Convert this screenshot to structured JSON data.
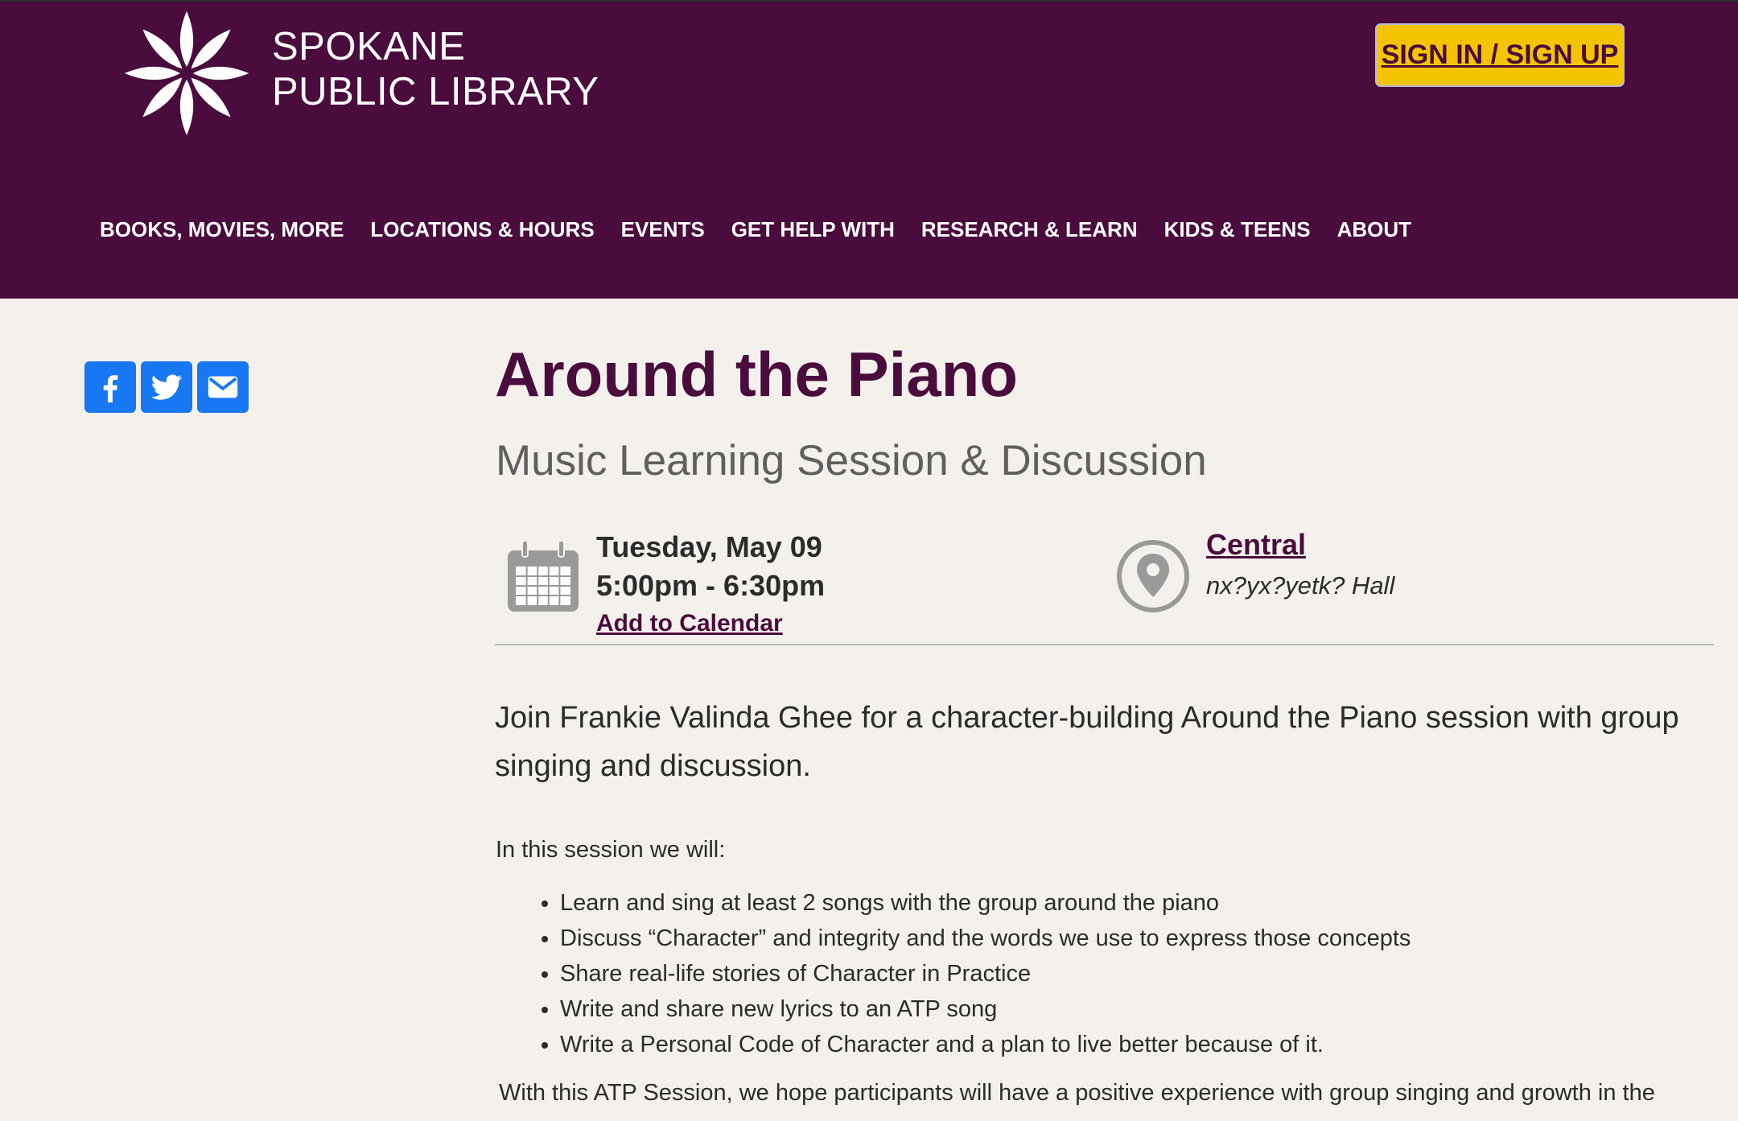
{
  "header": {
    "logo_line1": "SPOKANE",
    "logo_line2": "PUBLIC LIBRARY",
    "signin_label": "SIGN IN / SIGN UP",
    "nav": [
      "BOOKS, MOVIES, MORE",
      "LOCATIONS & HOURS",
      "EVENTS",
      "GET HELP WITH",
      "RESEARCH & LEARN",
      "KIDS & TEENS",
      "ABOUT"
    ]
  },
  "social": [
    "facebook-icon",
    "twitter-icon",
    "email-icon"
  ],
  "event": {
    "title": "Around the Piano",
    "subtitle": "Music Learning Session & Discussion",
    "date": "Tuesday, May 09",
    "time": "5:00pm - 6:30pm",
    "add_to_calendar": "Add to Calendar",
    "location": "Central",
    "room": "nx?yx?yetk? Hall",
    "intro": "Join Frankie Valinda Ghee for a character-building Around the Piano session with group singing and discussion.",
    "lead": "In this session we will:",
    "bullets": [
      "Learn and sing at least 2 songs with the group around the piano",
      "Discuss “Character” and integrity and the words we use to express those concepts",
      "Share real-life stories of Character in Practice",
      "Write and share new lyrics to an ATP song",
      "Write a Personal Code of Character and a plan to live better because of it."
    ],
    "closing": "With this ATP Session, we hope participants will have a positive experience with group singing and growth in the"
  },
  "colors": {
    "header_bg": "#4a0c3d",
    "page_bg": "#f4f1ec",
    "signin_bg": "#f5c400",
    "social_bg": "#1877f2"
  }
}
